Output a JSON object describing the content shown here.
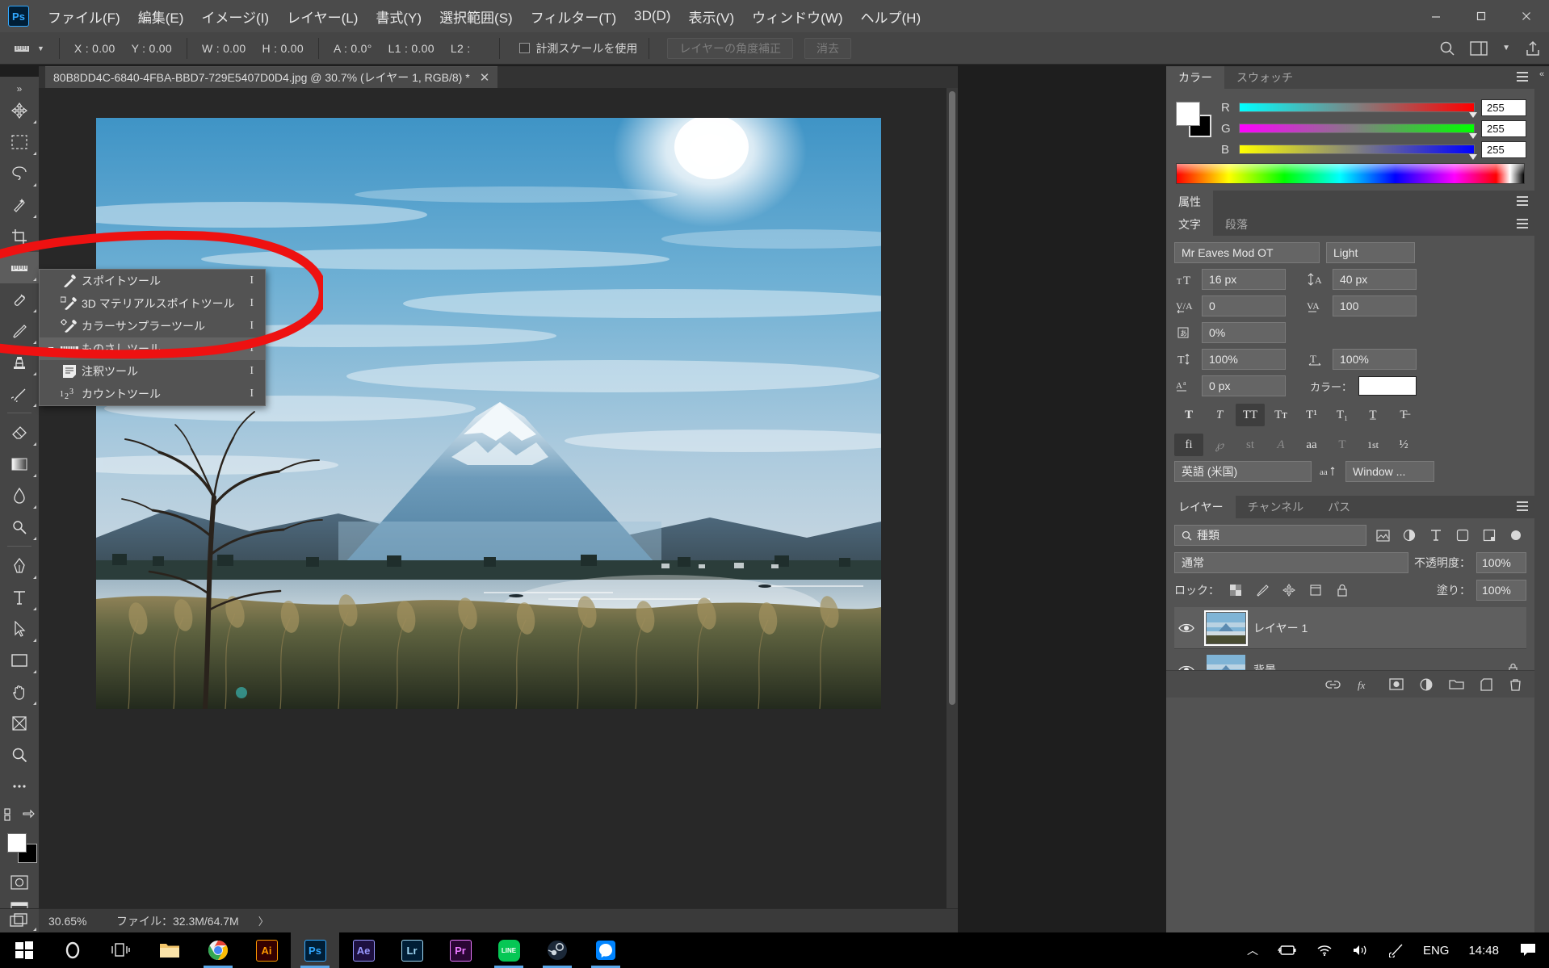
{
  "app": {
    "logo": "Ps",
    "menu": [
      "ファイル(F)",
      "編集(E)",
      "イメージ(I)",
      "レイヤー(L)",
      "書式(Y)",
      "選択範囲(S)",
      "フィルター(T)",
      "3D(D)",
      "表示(V)",
      "ウィンドウ(W)",
      "ヘルプ(H)"
    ],
    "window_controls": {
      "minimize": "—",
      "maximize": "❐",
      "close": "✕"
    }
  },
  "options_bar": {
    "tool_icon": "ruler-icon",
    "fields": [
      "X : 0.00",
      "Y : 0.00",
      "W : 0.00",
      "H : 0.00",
      "A : 0.0°",
      "L1 : 0.00",
      "L2 :"
    ],
    "checkbox_label": "計測スケールを使用",
    "checkbox_checked": false,
    "buttons": [
      "レイヤーの角度補正",
      "消去"
    ],
    "right_icons": [
      "search-icon",
      "workspace-icon",
      "chevron-down-icon",
      "share-icon"
    ]
  },
  "document": {
    "tab_title": "80B8DD4C-6840-4FBA-BBD7-729E5407D0D4.jpg @ 30.7% (レイヤー 1, RGB/8) *",
    "close_glyph": "✕"
  },
  "status_bar": {
    "zoom": "30.65%",
    "info": "ファイル：32.3M/64.7M",
    "arrow": "〉"
  },
  "toolbar": {
    "tools": [
      {
        "name": "move-tool",
        "glyph": "move"
      },
      {
        "name": "marquee-tool",
        "glyph": "marquee"
      },
      {
        "name": "lasso-tool",
        "glyph": "lasso"
      },
      {
        "name": "quick-selection-tool",
        "glyph": "wand"
      },
      {
        "name": "crop-tool",
        "glyph": "crop"
      },
      {
        "name": "eyedropper-ruler-tool",
        "glyph": "ruler",
        "selected": true
      },
      {
        "name": "healing-brush-tool",
        "glyph": "heal"
      },
      {
        "name": "brush-tool",
        "glyph": "brush"
      },
      {
        "name": "clone-stamp-tool",
        "glyph": "stamp"
      },
      {
        "name": "history-brush-tool",
        "glyph": "histbrush"
      },
      {
        "name": "eraser-tool",
        "glyph": "eraser"
      },
      {
        "name": "gradient-tool",
        "glyph": "gradient"
      },
      {
        "name": "blur-tool",
        "glyph": "blur"
      },
      {
        "name": "dodge-tool",
        "glyph": "dodge"
      },
      {
        "name": "pen-tool",
        "glyph": "pen"
      },
      {
        "name": "type-tool",
        "glyph": "type"
      },
      {
        "name": "path-selection-tool",
        "glyph": "arrow"
      },
      {
        "name": "rectangle-tool",
        "glyph": "rect"
      },
      {
        "name": "hand-tool",
        "glyph": "hand"
      },
      {
        "name": "rotate-view-tool",
        "glyph": "rotate"
      },
      {
        "name": "zoom-tool",
        "glyph": "zoom"
      },
      {
        "name": "more-tools",
        "glyph": "dots"
      }
    ],
    "edit_toolbar_glyph": "edit-toolbar-icon",
    "quickmask_glyph": "quickmask-icon",
    "screenmode_glyph": "screenmode-icon"
  },
  "flyout_menu": {
    "items": [
      {
        "label": "スポイトツール",
        "shortcut": "I",
        "icon": "eyedropper-icon",
        "active": false,
        "bullet": false
      },
      {
        "label": "3D マテリアルスポイトツール",
        "shortcut": "I",
        "icon": "3d-eyedropper-icon",
        "active": false,
        "bullet": false
      },
      {
        "label": "カラーサンプラーツール",
        "shortcut": "I",
        "icon": "color-sampler-icon",
        "active": false,
        "bullet": false
      },
      {
        "label": "ものさしツール",
        "shortcut": "I",
        "icon": "ruler-icon",
        "active": true,
        "bullet": true
      },
      {
        "label": "注釈ツール",
        "shortcut": "I",
        "icon": "note-icon",
        "active": false,
        "bullet": false
      },
      {
        "label": "カウントツール",
        "shortcut": "I",
        "icon": "count-icon",
        "active": false,
        "bullet": false
      }
    ]
  },
  "color_panel": {
    "tabs": [
      {
        "label": "カラー",
        "active": true
      },
      {
        "label": "スウォッチ",
        "active": false
      }
    ],
    "channels": [
      {
        "label": "R",
        "value": "255",
        "from": "#00ffff",
        "to": "#ff0000"
      },
      {
        "label": "G",
        "value": "255",
        "from": "#ff00ff",
        "to": "#00ff00"
      },
      {
        "label": "B",
        "value": "255",
        "from": "#ffff00",
        "to": "#0000ff"
      }
    ],
    "foreground": "#ffffff",
    "background": "#000000"
  },
  "properties_panel": {
    "tabs": [
      {
        "label": "属性",
        "active": true
      }
    ]
  },
  "character_panel": {
    "tabs": [
      {
        "label": "文字",
        "active": true
      },
      {
        "label": "段落",
        "active": false
      }
    ],
    "font_family": "Mr Eaves Mod OT",
    "font_style": "Light",
    "font_size": "16 px",
    "leading": "40 px",
    "kerning": "0",
    "tracking": "100",
    "vertical_scale_label": "0%",
    "horizontal_scale": "100%",
    "vertical_scale": "100%",
    "baseline_shift": "0 px",
    "color_label": "カラー：",
    "color_value": "#ffffff",
    "style_buttons": [
      "T",
      "T",
      "TT",
      "Tт",
      "T¹",
      "T₁",
      "T̲",
      "T̶"
    ],
    "opentype_buttons": [
      "fi",
      "℘",
      "st",
      "A",
      "aa",
      "T",
      "1st",
      "½"
    ],
    "language": "英語 (米国)",
    "antialias_icon": "aa-icon",
    "antialias": "Window ..."
  },
  "layers_panel": {
    "tabs": [
      {
        "label": "レイヤー",
        "active": true
      },
      {
        "label": "チャンネル",
        "active": false
      },
      {
        "label": "パス",
        "active": false
      }
    ],
    "filter_label": "種類",
    "filter_icons": [
      "image-filter-icon",
      "adjustment-filter-icon",
      "type-filter-icon",
      "shape-filter-icon",
      "smart-filter-icon",
      "toggle-filter-icon"
    ],
    "blend_mode": "通常",
    "opacity_label": "不透明度：",
    "opacity_value": "100%",
    "lock_label": "ロック：",
    "lock_icons": [
      "transparency-lock-icon",
      "brush-lock-icon",
      "move-lock-icon",
      "artboard-lock-icon",
      "all-lock-icon"
    ],
    "fill_label": "塗り：",
    "fill_value": "100%",
    "layers": [
      {
        "name": "レイヤー 1",
        "visible": true,
        "selected": true,
        "locked": false
      },
      {
        "name": "背景",
        "visible": true,
        "selected": false,
        "locked": true
      }
    ],
    "footer_icons": [
      "link-icon",
      "fx-icon",
      "mask-icon",
      "adjustment-icon",
      "group-icon",
      "new-layer-icon",
      "delete-icon"
    ]
  },
  "annotation": {
    "color": "#ee1111",
    "shape": "hand-drawn-circle"
  },
  "taskbar": {
    "items": [
      {
        "name": "start-button",
        "label": "⊞"
      },
      {
        "name": "cortana-button",
        "label": "◯"
      },
      {
        "name": "task-view-button",
        "label": "❙❙❙"
      },
      {
        "name": "file-explorer",
        "label": "📁"
      },
      {
        "name": "chrome",
        "label": "chrome"
      },
      {
        "name": "illustrator",
        "label": "Ai",
        "color": "#ff9a00",
        "bg": "#330000"
      },
      {
        "name": "photoshop",
        "label": "Ps",
        "color": "#31a8ff",
        "bg": "#001e36",
        "active": true
      },
      {
        "name": "after-effects",
        "label": "Ae",
        "color": "#9999ff",
        "bg": "#1d1040"
      },
      {
        "name": "lightroom",
        "label": "Lr",
        "color": "#9fd7f3",
        "bg": "#001e36"
      },
      {
        "name": "premiere",
        "label": "Pr",
        "color": "#ea77ff",
        "bg": "#2a0634"
      },
      {
        "name": "line",
        "label": "LINE",
        "color": "#ffffff",
        "bg": "#06c755"
      },
      {
        "name": "steam",
        "label": "steam"
      },
      {
        "name": "messenger",
        "label": "messenger"
      }
    ],
    "tray": {
      "chevron": "︿",
      "icons": [
        "battery-icon",
        "wifi-icon",
        "volume-icon",
        "pen-icon"
      ],
      "language": "ENG",
      "clock": "14:48",
      "notification": "notification-icon"
    }
  }
}
